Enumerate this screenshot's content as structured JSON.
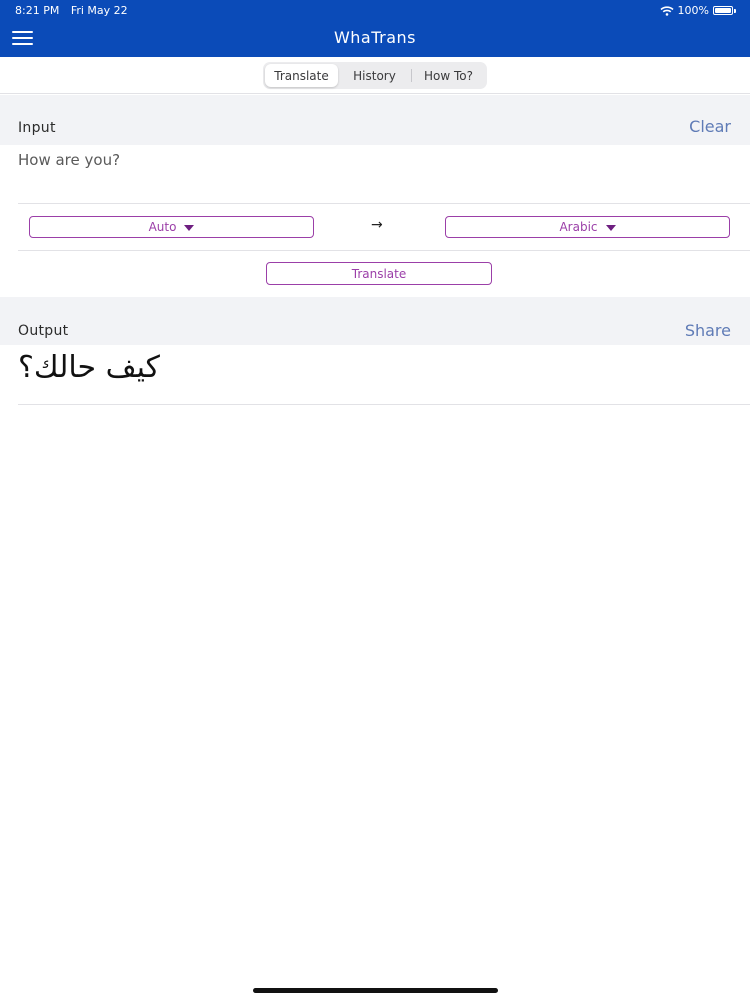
{
  "status_bar": {
    "time": "8:21 PM",
    "date": "Fri May 22",
    "battery": "100%"
  },
  "header": {
    "title": "WhaTrans"
  },
  "tabs": [
    {
      "label": "Translate",
      "active": true
    },
    {
      "label": "History",
      "active": false
    },
    {
      "label": "How To?",
      "active": false
    }
  ],
  "input_section": {
    "label": "Input",
    "action": "Clear",
    "text": "How are you?"
  },
  "languages": {
    "source": "Auto",
    "target": "Arabic",
    "arrow": "→"
  },
  "translate_button": "Translate",
  "output_section": {
    "label": "Output",
    "action": "Share",
    "text": "كيف حالك؟"
  },
  "colors": {
    "header_bg": "#0b4bb8",
    "accent": "#9b3fa8",
    "link": "#5f7bb6"
  }
}
